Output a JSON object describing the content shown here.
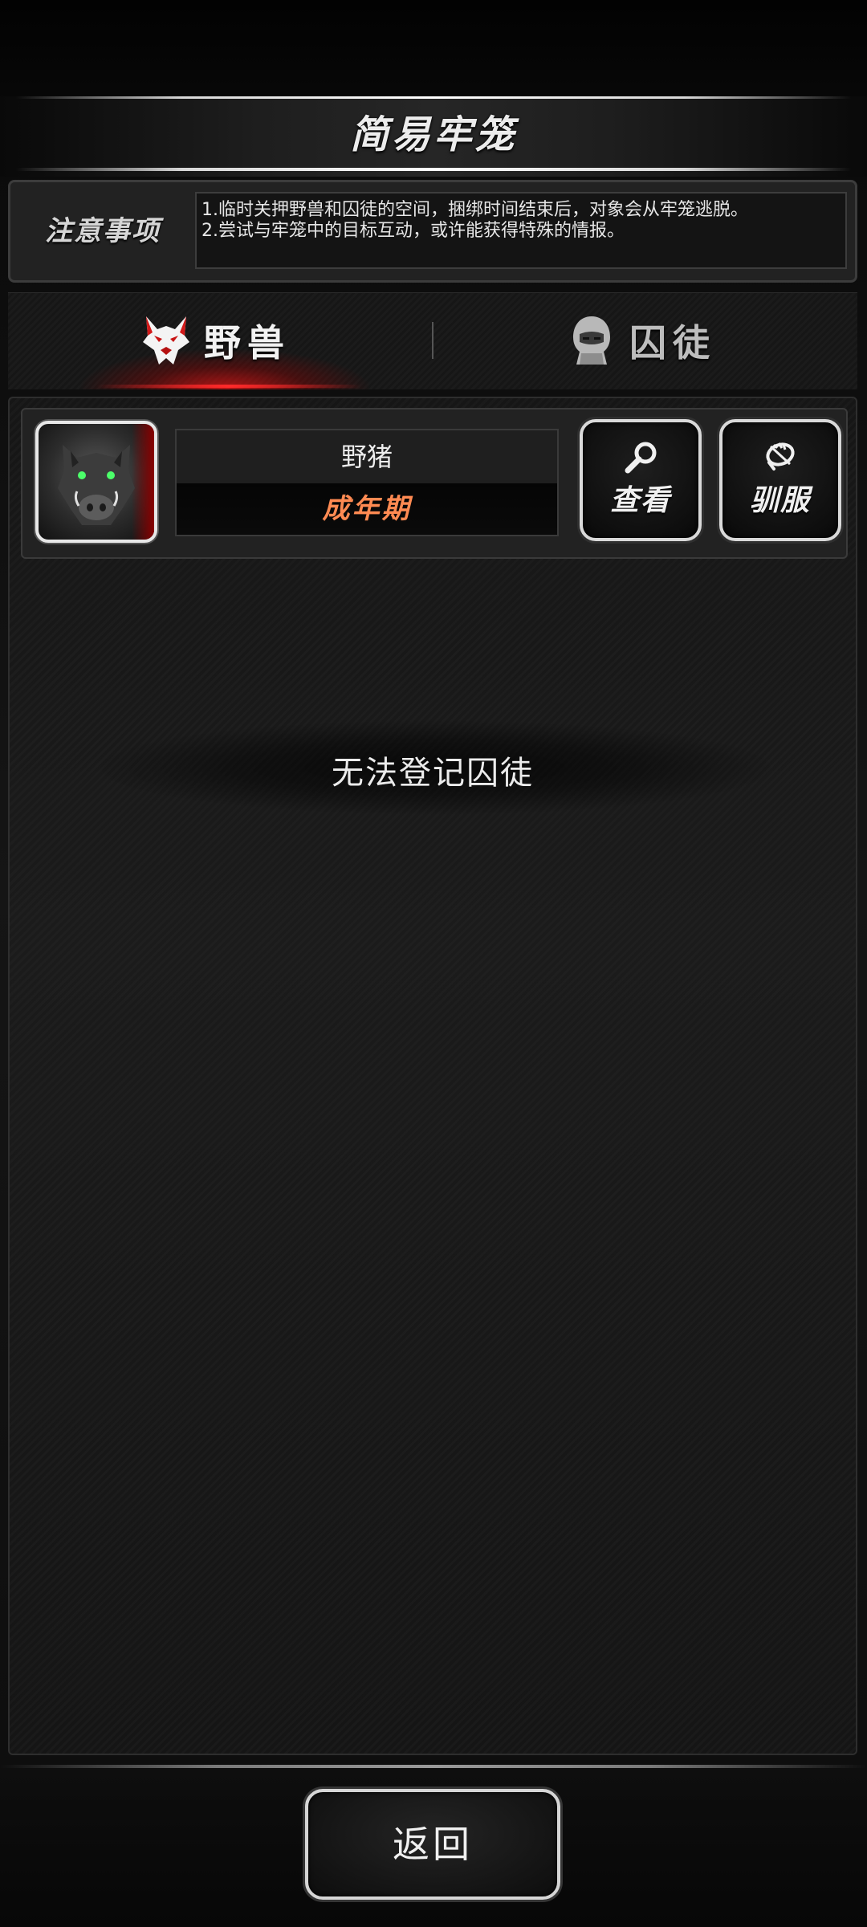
{
  "header": {
    "title": "简易牢笼"
  },
  "notice": {
    "title": "注意事项",
    "lines": [
      "1.临时关押野兽和囚徒的空间，捆绑时间结束后，对象会从牢笼逃脱。",
      "2.尝试与牢笼中的目标互动，或许能获得特殊的情报。"
    ]
  },
  "tabs": [
    {
      "label": "野兽",
      "icon": "wolf-icon",
      "active": true
    },
    {
      "label": "囚徒",
      "icon": "hooded-prisoner-icon",
      "active": false
    }
  ],
  "beast": {
    "name": "野猪",
    "stage": "成年期",
    "avatar_icon": "boar-icon",
    "actions": [
      {
        "label": "查看",
        "icon": "magnifier-icon"
      },
      {
        "label": "驯服",
        "icon": "rope-lasso-icon"
      }
    ]
  },
  "empty_message": "无法登记囚徒",
  "footer": {
    "back_label": "返回"
  },
  "colors": {
    "active_tab_glow": "#ff2a2a",
    "stage_text": "#ff8a52",
    "background": "#151515"
  }
}
